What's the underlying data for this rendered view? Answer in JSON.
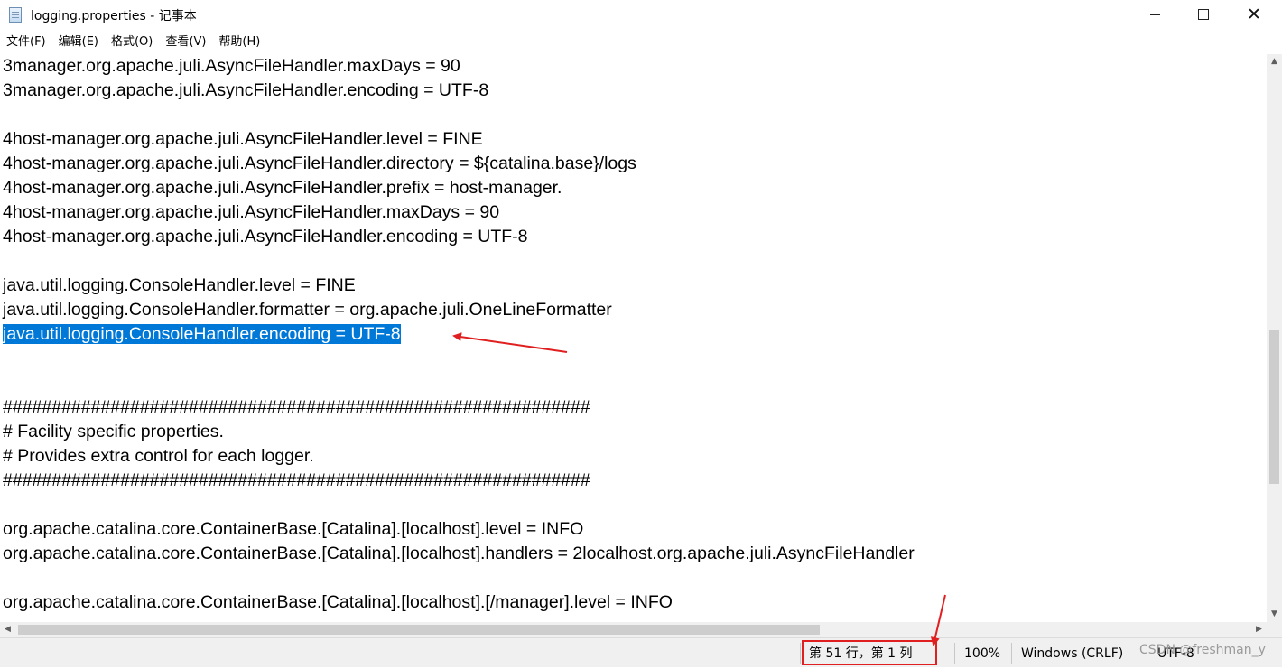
{
  "window": {
    "title": "logging.properties - 记事本",
    "minimize_icon": "minimize-icon",
    "maximize_icon": "maximize-icon",
    "close_icon": "close-icon"
  },
  "menu": [
    "文件(F)",
    "编辑(E)",
    "格式(O)",
    "查看(V)",
    "帮助(H)"
  ],
  "editor": {
    "lines": [
      "3manager.org.apache.juli.AsyncFileHandler.maxDays = 90",
      "3manager.org.apache.juli.AsyncFileHandler.encoding = UTF-8",
      "",
      "4host-manager.org.apache.juli.AsyncFileHandler.level = FINE",
      "4host-manager.org.apache.juli.AsyncFileHandler.directory = ${catalina.base}/logs",
      "4host-manager.org.apache.juli.AsyncFileHandler.prefix = host-manager.",
      "4host-manager.org.apache.juli.AsyncFileHandler.maxDays = 90",
      "4host-manager.org.apache.juli.AsyncFileHandler.encoding = UTF-8",
      "",
      "java.util.logging.ConsoleHandler.level = FINE",
      "java.util.logging.ConsoleHandler.formatter = org.apache.juli.OneLineFormatter",
      "java.util.logging.ConsoleHandler.encoding = UTF-8",
      "",
      "",
      "############################################################",
      "# Facility specific properties.",
      "# Provides extra control for each logger.",
      "############################################################",
      "",
      "org.apache.catalina.core.ContainerBase.[Catalina].[localhost].level = INFO",
      "org.apache.catalina.core.ContainerBase.[Catalina].[localhost].handlers = 2localhost.org.apache.juli.AsyncFileHandler",
      "",
      "org.apache.catalina.core.ContainerBase.[Catalina].[localhost].[/manager].level = INFO"
    ],
    "selected_line_index": 11
  },
  "status": {
    "position": "第 51 行，第 1 列",
    "zoom": "100%",
    "line_ending": "Windows (CRLF)",
    "encoding": "UTF-8"
  },
  "watermark": "CSDN @freshman_y",
  "colors": {
    "selection": "#0078d7",
    "annotation": "#e02020"
  }
}
